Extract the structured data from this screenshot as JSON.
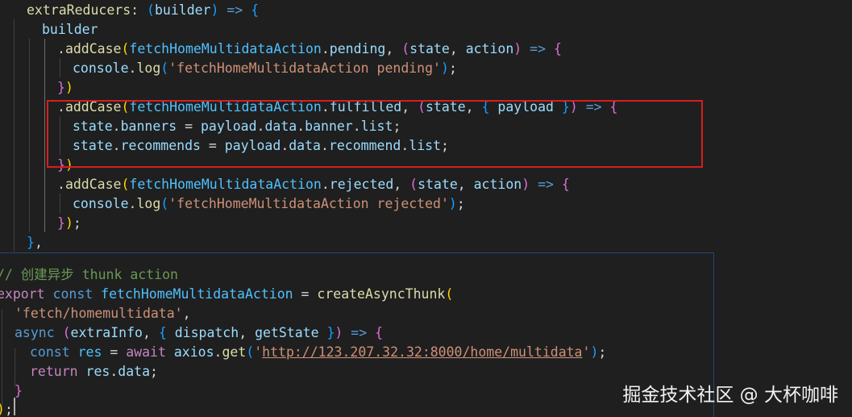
{
  "code": {
    "extra_reducers_prop": "extraReducers",
    "builder": "builder",
    "action_name": "fetchHomeMultidataAction",
    "add_case": "addCase",
    "pending": "pending",
    "fulfilled": "fulfilled",
    "rejected": "rejected",
    "state": "state",
    "action": "action",
    "payload": "payload",
    "console": "console",
    "log": "log",
    "pending_msg": "'fetchHomeMultidataAction pending'",
    "rejected_msg": "'fetchHomeMultidataAction rejected'",
    "banners": "banners",
    "recommends": "recommends",
    "data": "data",
    "banner": "banner",
    "recommend": "recommend",
    "list": "list",
    "comment": "// 创建异步 thunk action",
    "export_kw": "export",
    "const_kw": "const",
    "create_async_thunk": "createAsyncThunk",
    "type_string": "'fetch/homemultidata'",
    "async_kw": "async",
    "extra_info": "extraInfo",
    "dispatch": "dispatch",
    "get_state": "getState",
    "res": "res",
    "await_kw": "await",
    "axios": "axios",
    "get": "get",
    "url_quote_open": "'",
    "url": "http://123.207.32.32:8000/home/multidata",
    "url_quote_close": "'",
    "return_kw": "return"
  },
  "watermark": "掘金技术社区 @ 大杯咖啡",
  "colors": {
    "background": "#1f1f1f",
    "highlight_box": "#d81e1e",
    "keyword": "#c586c0",
    "storage": "#569cd6",
    "function": "#dcdcaa",
    "variable": "#9cdcfe",
    "constant": "#4fc1ff",
    "string": "#ce9178",
    "comment": "#6a9955"
  }
}
